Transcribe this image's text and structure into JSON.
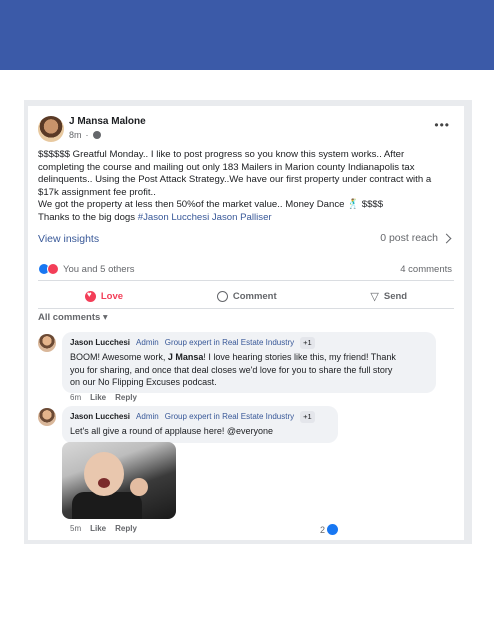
{
  "post": {
    "author": "J Mansa Malone",
    "time": "8m",
    "more": "•••",
    "text_lines": [
      "$$$$$$ Greatful Monday.. I like to post progress so you know this system works.. After",
      "completing the course and mailing out only 183 Mailers in Marion county Indianapolis tax",
      "delinquents.. Using the Post Attack Strategy..We have our first property under contract with a",
      "$17k assignment fee profit..",
      "We got the property at less then 50%of the market value.. Money Dance 🕺 $$$$"
    ],
    "thanks_prefix": "Thanks to the big dogs ",
    "tag_1": "#Jason Lucchesi",
    "tag_2": "Jason Palliser",
    "view_insights": "View insights",
    "post_reach": "0 post reach",
    "reactions_text": "You and 5 others",
    "comments_count": "4 comments",
    "actions": {
      "love": "Love",
      "comment": "Comment",
      "send": "Send"
    },
    "all_comments": "All comments ▾"
  },
  "comments": [
    {
      "name": "Jason Lucchesi",
      "admin": "Admin",
      "expert": "Group expert in Real Estate Industry",
      "plus": "+1",
      "text_before": "BOOM! Awesome work, ",
      "bold": "J Mansa",
      "text_lines_after": [
        "! I love hearing stories like this, my friend! Thank",
        "you for sharing, and once that deal closes we'd love for you to share the full story",
        "on our No Flipping Excuses podcast."
      ],
      "time": "6m",
      "like": "Like",
      "reply": "Reply"
    },
    {
      "name": "Jason Lucchesi",
      "admin": "Admin",
      "expert": "Group expert in Real Estate Industry",
      "plus": "+1",
      "text": "Let's all give a round of applause here! @everyone",
      "time": "5m",
      "like": "Like",
      "reply": "Reply",
      "like_count": "2"
    }
  ],
  "colors": {
    "brand": "#3b5aa8",
    "link": "#385898",
    "love": "#f33e58",
    "like": "#1877f2"
  }
}
